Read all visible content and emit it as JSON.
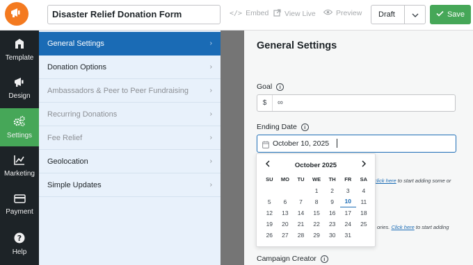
{
  "header": {
    "form_title": "Disaster Relief Donation Form",
    "embed_label": "Embed",
    "view_live_label": "View Live",
    "preview_label": "Preview",
    "status_value": "Draft",
    "save_label": "Save",
    "brand_color": "#f47a20",
    "save_color": "#46a758"
  },
  "leftnav": {
    "items": [
      {
        "label": "Template",
        "icon": "template-icon"
      },
      {
        "label": "Design",
        "icon": "megaphone-icon"
      },
      {
        "label": "Settings",
        "icon": "gears-icon",
        "active": true
      },
      {
        "label": "Marketing",
        "icon": "chart-icon"
      },
      {
        "label": "Payment",
        "icon": "credit-card-icon"
      },
      {
        "label": "Help",
        "icon": "help-icon"
      }
    ]
  },
  "settings": {
    "items": [
      {
        "label": "General Settings",
        "active": true
      },
      {
        "label": "Donation Options"
      },
      {
        "label": "Ambassadors & Peer to Peer Fundraising",
        "disabled": true
      },
      {
        "label": "Recurring Donations",
        "disabled": true
      },
      {
        "label": "Fee Relief",
        "disabled": true
      },
      {
        "label": "Geolocation"
      },
      {
        "label": "Simple Updates"
      }
    ],
    "active_color": "#1a6bb5"
  },
  "panel": {
    "title": "General Settings",
    "goal_label": "Goal",
    "goal_prefix": "$",
    "goal_value": "∞",
    "ending_date_label": "Ending Date",
    "ending_date_value": "October 10, 2025",
    "helper1_link": "click here",
    "helper1_text": " to start adding some or",
    "helper2_text": "ories. ",
    "helper2_link": "Click here",
    "helper2_tail": " to start adding",
    "campaign_creator_label": "Campaign Creator"
  },
  "calendar": {
    "month_label": "October 2025",
    "prev": "‹",
    "next": "›",
    "weekdays": [
      "SU",
      "MO",
      "TU",
      "WE",
      "TH",
      "FR",
      "SA"
    ],
    "weeks": [
      [
        "",
        "",
        "",
        "1",
        "2",
        "3",
        "4"
      ],
      [
        "5",
        "6",
        "7",
        "8",
        "9",
        "10",
        "11"
      ],
      [
        "12",
        "13",
        "14",
        "15",
        "16",
        "17",
        "18"
      ],
      [
        "19",
        "20",
        "21",
        "22",
        "23",
        "24",
        "25"
      ],
      [
        "26",
        "27",
        "28",
        "29",
        "30",
        "31",
        ""
      ]
    ],
    "selected": "10"
  }
}
